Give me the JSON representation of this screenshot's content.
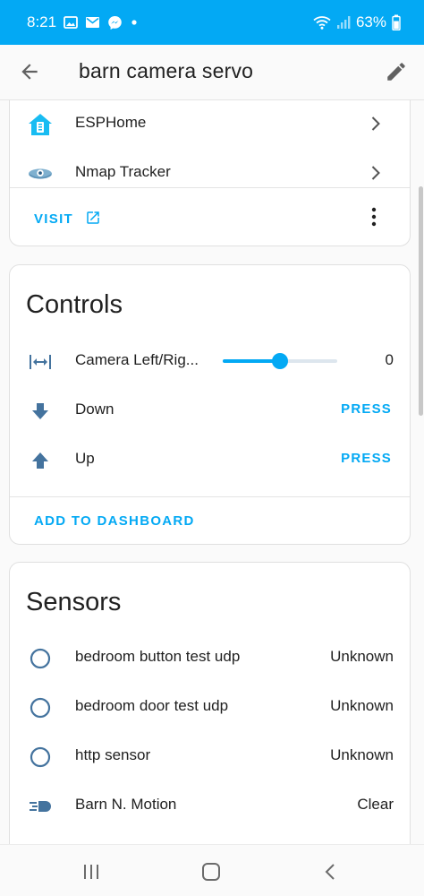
{
  "status_bar": {
    "time": "8:21",
    "battery": "63%",
    "notification_icons": [
      "gallery-icon",
      "mail-icon",
      "messenger-icon",
      "dot-icon"
    ]
  },
  "app_bar": {
    "title": "barn camera servo"
  },
  "integrations_card": {
    "items": [
      {
        "label": "ESPHome",
        "icon": "esphome-icon"
      },
      {
        "label": "Nmap Tracker",
        "icon": "nmap-icon"
      }
    ],
    "visit_label": "VISIT"
  },
  "controls_card": {
    "title": "Controls",
    "slider": {
      "label": "Camera Left/Rig...",
      "value": "0",
      "fraction": 0.5
    },
    "buttons": [
      {
        "label": "Down",
        "action": "PRESS"
      },
      {
        "label": "Up",
        "action": "PRESS"
      }
    ],
    "add_label": "ADD TO DASHBOARD"
  },
  "sensors_card": {
    "title": "Sensors",
    "items": [
      {
        "label": "bedroom button test udp",
        "value": "Unknown"
      },
      {
        "label": "bedroom door test udp",
        "value": "Unknown"
      },
      {
        "label": "http sensor",
        "value": "Unknown"
      },
      {
        "label": "Barn N. Motion",
        "value": "Clear"
      }
    ]
  },
  "colors": {
    "primary": "#03a9f4",
    "icon": "#44739e",
    "text": "#212121"
  }
}
